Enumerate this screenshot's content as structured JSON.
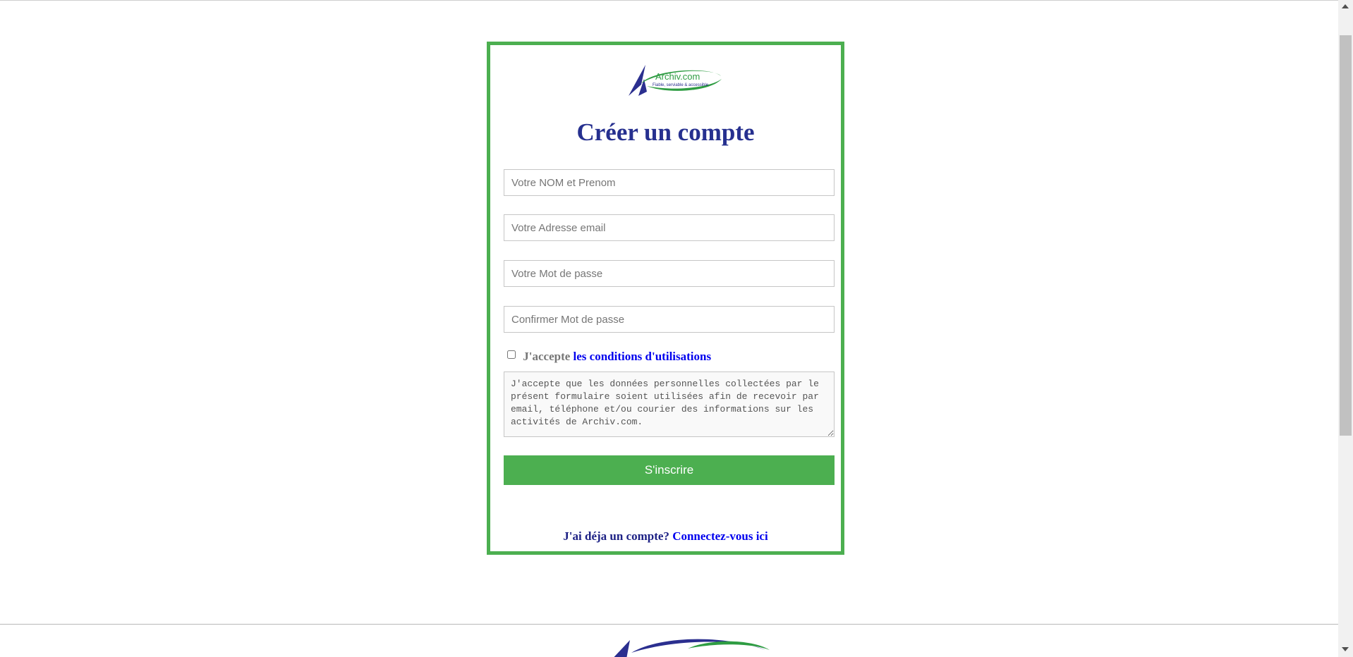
{
  "logo": {
    "name": "Archiv.com",
    "tagline": "Fiable, serviable & accessible"
  },
  "form": {
    "title": "Créer un compte",
    "fields": {
      "name_placeholder": "Votre NOM et Prenom",
      "email_placeholder": "Votre Adresse email",
      "password_placeholder": "Votre Mot de passe",
      "confirm_placeholder": "Confirmer Mot de passe"
    },
    "terms": {
      "accept_label": "J'accepte",
      "link_text": "les conditions d'utilisations",
      "checked": false
    },
    "consent_text": "J'accepte que les données personnelles collectées par le présent formulaire soient utilisées afin de recevoir par email, téléphone et/ou courier des informations sur les activités de Archiv.com.",
    "submit_label": "S'inscrire",
    "login_prompt": "J'ai déja un compte?",
    "login_link": "Connectez-vous ici"
  },
  "colors": {
    "accent_green": "#4caf50",
    "title_blue": "#26308f",
    "link_blue": "#0000ee"
  }
}
